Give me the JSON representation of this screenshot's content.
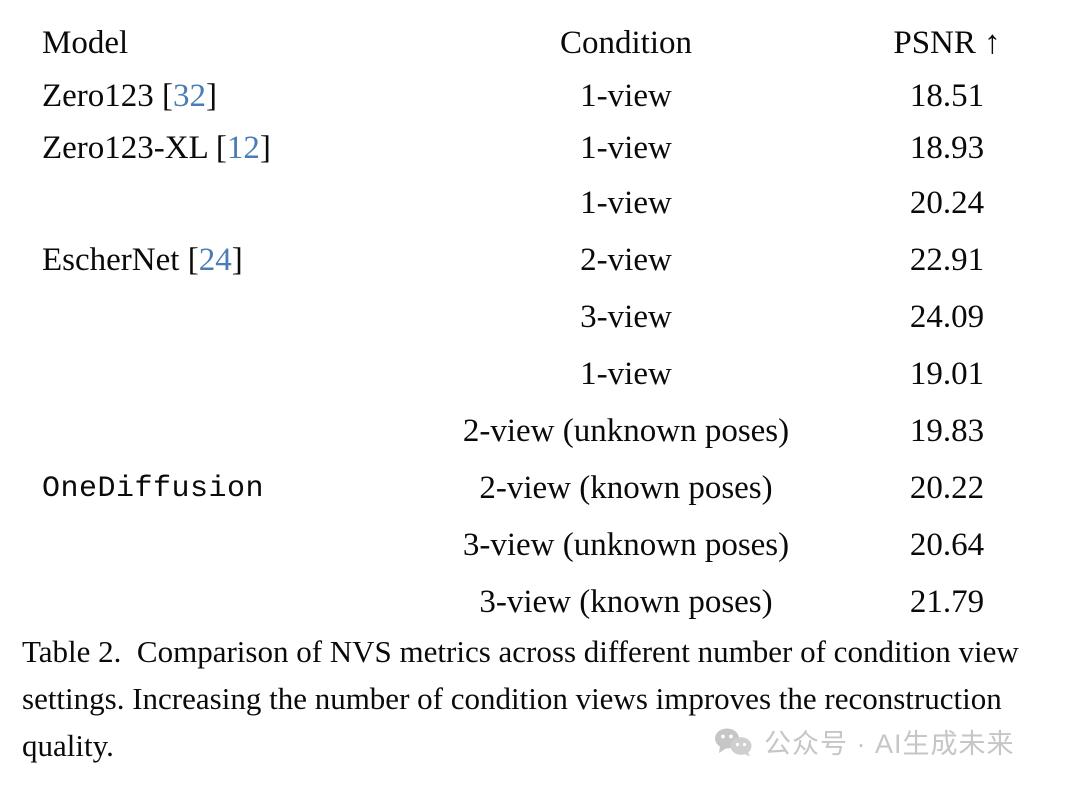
{
  "table": {
    "columns": [
      "Model",
      "Condition",
      "PSNR ↑"
    ],
    "column_names": {
      "model": "Model",
      "condition": "Condition",
      "psnr": "PSNR ↑"
    },
    "groups": [
      {
        "rows": [
          {
            "model": "Zero123",
            "citation": "32",
            "condition": "1-view",
            "psnr": "18.51"
          },
          {
            "model": "Zero123-XL",
            "citation": "12",
            "condition": "1-view",
            "psnr": "18.93"
          }
        ]
      },
      {
        "model": "EscherNet",
        "citation": "24",
        "mono": false,
        "rows": [
          {
            "condition": "1-view",
            "psnr": "20.24"
          },
          {
            "condition": "2-view",
            "psnr": "22.91"
          },
          {
            "condition": "3-view",
            "psnr": "24.09"
          }
        ]
      },
      {
        "model": "OneDiffusion",
        "citation": "",
        "mono": true,
        "rows": [
          {
            "condition": "1-view",
            "psnr": "19.01"
          },
          {
            "condition": "2-view (unknown poses)",
            "psnr": "19.83"
          },
          {
            "condition": "2-view (known poses)",
            "psnr": "20.22"
          },
          {
            "condition": "3-view (unknown poses)",
            "psnr": "20.64"
          },
          {
            "condition": "3-view (known poses)",
            "psnr": "21.79"
          }
        ]
      }
    ]
  },
  "caption": {
    "label": "Table 2.",
    "text": "Comparison of NVS metrics across different number of condition view settings. Increasing the number of condition views improves the reconstruction quality.",
    "full": "Table 2.  Comparison of NVS metrics across different number of condition view settings. Increasing the number of condition views improves the reconstruction quality."
  },
  "watermark": {
    "icon": "wechat-icon",
    "text": "公众号 · AI生成未来",
    "color": "#c6c6c6"
  },
  "colors": {
    "citation_blue": "#4a7db5",
    "text": "#0a0a0a",
    "rule": "#1a1a1a",
    "background": "#ffffff",
    "watermark": "#c6c6c6"
  },
  "chart_data": {
    "type": "table",
    "title": "Comparison of NVS metrics across different number of condition view settings",
    "columns": [
      "Model",
      "Condition",
      "PSNR ↑"
    ],
    "rows": [
      [
        "Zero123 [32]",
        "1-view",
        18.51
      ],
      [
        "Zero123-XL [12]",
        "1-view",
        18.93
      ],
      [
        "EscherNet [24]",
        "1-view",
        20.24
      ],
      [
        "EscherNet [24]",
        "2-view",
        22.91
      ],
      [
        "EscherNet [24]",
        "3-view",
        24.09
      ],
      [
        "OneDiffusion",
        "1-view",
        19.01
      ],
      [
        "OneDiffusion",
        "2-view (unknown poses)",
        19.83
      ],
      [
        "OneDiffusion",
        "2-view (known poses)",
        20.22
      ],
      [
        "OneDiffusion",
        "3-view (unknown poses)",
        20.64
      ],
      [
        "OneDiffusion",
        "3-view (known poses)",
        21.79
      ]
    ],
    "ylabel": "PSNR",
    "xlabel": "Condition",
    "grid": false
  }
}
